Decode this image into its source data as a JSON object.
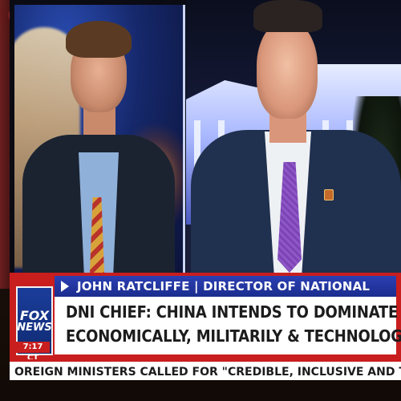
{
  "network": {
    "logo_top": "FOX",
    "logo_bottom": "NEWS",
    "clock": "7:17 CT"
  },
  "lower_third": {
    "name_title": "JOHN RATCLIFFE | DIRECTOR OF NATIONAL INTELLIGENCE",
    "headline_line1": "DNI CHIEF: CHINA INTENDS TO DOMINATE THE U.S.",
    "headline_line2": "ECONOMICALLY, MILITARILY & TECHNOLOGICALLY",
    "ticker": "OREIGN MINISTERS CALLED FOR \"CREDIBLE, INCLUSIVE AND TRANSPARENT PRESIDENTIAL AND LEGISLATIVE"
  },
  "colors": {
    "brand_red": "#c81e1e",
    "brand_blue": "#1b2d8e",
    "tie_purple": "#8d57c6"
  }
}
